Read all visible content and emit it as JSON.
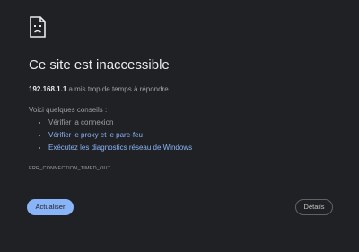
{
  "icon": "sad-page-icon",
  "title": "Ce site est inaccessible",
  "lead": {
    "host": "192.168.1.1",
    "message": " a mis trop de temps à répondre."
  },
  "tips_label": "Voici quelques conseils :",
  "tips": [
    {
      "label": "Vérifier la connexion",
      "is_link": false
    },
    {
      "label": "Vérifier le proxy et le pare-feu",
      "is_link": true
    },
    {
      "label": "Exécutez les diagnostics réseau de Windows",
      "is_link": true
    }
  ],
  "error_code": "ERR_CONNECTION_TIMED_OUT",
  "buttons": {
    "reload_label": "Actualiser",
    "details_label": "Détails"
  },
  "colors": {
    "background": "#202124",
    "title": "#e8eaed",
    "body_text": "#9aa0a6",
    "link": "#8ab4f8",
    "primary_button": "#8ab4f8"
  }
}
